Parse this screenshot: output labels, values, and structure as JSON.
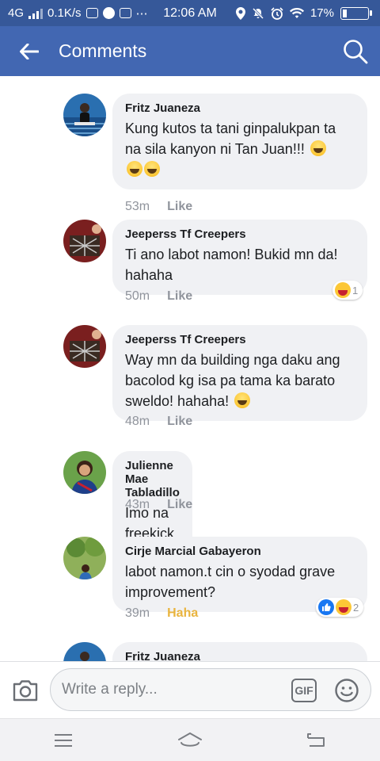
{
  "status_bar": {
    "network": "4G",
    "speed": "0.1K/s",
    "time": "12:06 AM",
    "battery": "17%",
    "battery_level": 0.17
  },
  "header": {
    "title": "Comments",
    "color": "#4267b2"
  },
  "comments": [
    {
      "author": "Fritz Juaneza",
      "text": "Kung kutos ta tani ginpalukpan ta na sila kanyon ni Tan Juan!!!",
      "emoji_count": 3,
      "time": "53m",
      "action": "Like"
    },
    {
      "author": "Jeeperss Tf Creepers",
      "text": "Ti ano labot namon! Bukid mn da! hahaha",
      "emoji_count": 0,
      "time": "50m",
      "action": "Like",
      "reaction_count": "1"
    },
    {
      "author": "Jeeperss Tf Creepers",
      "text": "Way mn da building nga daku ang bacolod kg isa pa tama ka barato sweldo! hahaha!",
      "emoji_count": 1,
      "time": "48m",
      "action": "Like"
    },
    {
      "author": "Julienne Mae Tabladillo",
      "text": "Imo na freekick",
      "emoji_count": 1,
      "time": "43m",
      "action": "Like"
    },
    {
      "author": "Cirje Marcial Gabayeron",
      "text": "labot namon.t cin o syodad grave improvement?",
      "emoji_count": 0,
      "time": "39m",
      "action": "Haha",
      "reaction_count": "2"
    },
    {
      "author": "Fritz Juaneza"
    }
  ],
  "reply": {
    "placeholder": "Write a reply...",
    "gif_label": "GIF"
  },
  "colors": {
    "status_bar": "#365899",
    "bubble": "#f0f1f4",
    "meta": "#90949c",
    "haha_active": "#e9b43e"
  }
}
